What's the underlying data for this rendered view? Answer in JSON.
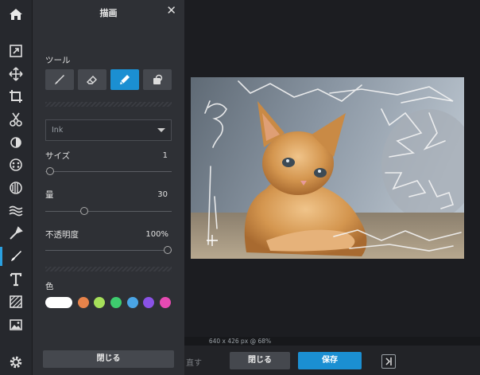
{
  "panel": {
    "title": "描画",
    "close": "✕",
    "tools_label": "ツール",
    "tools": [
      "brush-icon",
      "eraser-icon",
      "pen-icon",
      "clone-icon"
    ],
    "selected_tool": "pen-icon",
    "brush_select": "Ink",
    "size_label": "サイズ",
    "size_value": "1",
    "amount_label": "量",
    "amount_value": "30",
    "opacity_label": "不透明度",
    "opacity_value": "100%",
    "color_label": "色",
    "colors": [
      "#ffffff",
      "#e8834a",
      "#a6e05a",
      "#3ecc6e",
      "#4aa5e6",
      "#8a52e6",
      "#e64ab2"
    ],
    "close_button": "閉じる"
  },
  "status": {
    "info": "640 x 426 px @ 68%"
  },
  "bottom": {
    "faded": "直す",
    "close_button": "閉じる",
    "save_button": "保存"
  },
  "toolbar": [
    "home-icon",
    "crop-expand-icon",
    "move-icon",
    "crop-icon",
    "cut-icon",
    "adjust-icon",
    "effects-icon",
    "tone-icon",
    "wave-icon",
    "dropper-icon",
    "draw-icon",
    "text-icon",
    "pattern-icon",
    "image-icon",
    "settings-icon"
  ],
  "accent": "#1b8fd2"
}
